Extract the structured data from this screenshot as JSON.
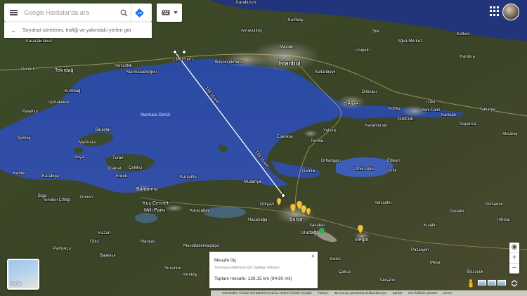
{
  "search": {
    "placeholder": "Google Haritalar'da ara",
    "travel_hint": "Seyahat sürelerini, trafiği ve yakındaki yerleri gör"
  },
  "labels": {
    "karaburun": "Karaburun",
    "kurnkoy": "Kumköy",
    "arnavutkoy": "Arnavutköy",
    "maslak": "Maslak",
    "istanbul": "İstanbul",
    "sile": "Şile",
    "kefken": "Kefken",
    "kandira": "Kandıra",
    "agva": "Ağva Merkez",
    "ulupelit": "Ulupelit",
    "buyukcekmece": "Büyükçekmece",
    "sultanbeyli": "Sultanbeyli",
    "tekirdag": "Tekirdağ",
    "yeniciftlik": "Yeniçiftlik",
    "marmaraereglisi": "Marmaraereğlisi",
    "karacakilavuz": "Karacakılavuz",
    "generli": "Generli",
    "kumbag": "Kumbağ",
    "ucmakdere": "Uçmakdere",
    "palamut": "Palamut",
    "sarkoy": "Şarköy",
    "marmara_denizi": "Marmara Denizi",
    "saraylar": "Saraylar",
    "marmara": "Marmara",
    "avsa": "Avşa",
    "turan": "Turan",
    "ocaklar": "Ocaklar",
    "erdek": "Erdek",
    "celtikci": "Çeltikçi",
    "kemer": "Kemer",
    "karabiga": "Karabiga",
    "bandirma": "Bandırma",
    "kursunlu": "Kurşunlu",
    "mudanya": "Mudanya",
    "gemlik": "Gemlik",
    "orhangazi": "Orhangazi",
    "iznik_golu": "İznik Gölü",
    "iznik": "İznik",
    "elbeyli": "Elbeyli",
    "yalova": "Yalova",
    "esenkoy": "Esenköy",
    "termal": "Termal",
    "gebze": "Gebze",
    "korfez": "Körfez",
    "golcuk": "Gölcük",
    "karamursel": "Karamürsel",
    "izmit": "İzmit",
    "kartepe": "Kartepe",
    "sapanca": "Sapanca",
    "sakarya": "Sakarya",
    "yeni_fatih": "Yeni Fatih",
    "dilovasi": "Dilovası",
    "bursa": "Bursa",
    "uludag": "Uludağ",
    "inegol": "İnegöl",
    "yenisehir": "Yenişehir",
    "pazaryeri": "Pazaryeri",
    "kus_cenneti": "Kuş Cenneti",
    "milli_parki": "Milli Parkı",
    "karacabey": "Karacabey",
    "mustafakemalpasa": "Mustafakemalpaşa",
    "manyas": "Manyas",
    "gonen": "Gönen",
    "biga": "Biga",
    "sinobel": "Sinobel Çiftliği",
    "golyazi": "Gölyazı",
    "hasanaga": "Hasanağa",
    "kulakli": "Kulaklı",
    "dudakli": "Dudaklı",
    "osmaneli": "Osmaneli",
    "aksaray": "Aksaray",
    "kazan": "Kazan",
    "golu": "Gölü",
    "pamukcu": "Pamukçu",
    "balikesir": "Balıkesir",
    "susurluk": "Susurluk",
    "yenikoy": "Yeniköy",
    "calica": "Çalıca",
    "bozuyuk": "Bozüyük",
    "inhisar": "İnhisar",
    "saitabat": "Saitabat",
    "tavsanli": "Tavşanlı",
    "keles": "Keles",
    "mesa": "Mesa"
  },
  "measure": {
    "km_badge": "136,15 km",
    "seg1": "136,15 km",
    "seg2": "136,15 km",
    "title": "Mesafe ölç",
    "hint": "Yolunuzu eklemek için haritayı tıklayın",
    "total": "Toplam mesafe: 136,15 km (84,60 mil)"
  },
  "minimap": {
    "label": "Harita"
  },
  "footer": {
    "imagery": "Görüntüler ©2020 TerraMetrics,Harita verileri ©2020 Google",
    "country": "Türkiye",
    "terms": "3D Dünya görüntüsü kullanılamıyor",
    "conditions": "Şartlar",
    "feedback": "Geri bildirim gönder",
    "scale": "10 km"
  },
  "colors": {
    "sea": "#2e4ea6",
    "land": "#3a4a27",
    "urban": "#8d8b7e",
    "pin": "#f2c43d",
    "route": "#ffffff"
  }
}
